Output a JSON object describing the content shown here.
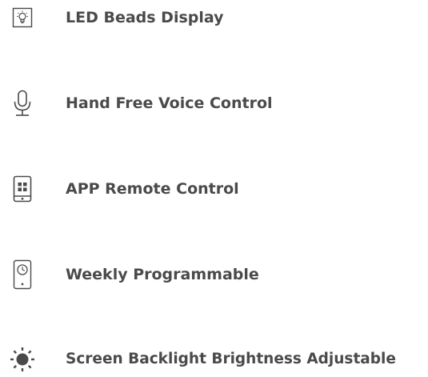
{
  "colors": {
    "text": "#4a4a4a",
    "icon": "#4a4a4a"
  },
  "features": [
    {
      "label": "LED Beads Display",
      "icon": "led-bulb-icon"
    },
    {
      "label": "Hand Free Voice Control",
      "icon": "microphone-icon"
    },
    {
      "label": "APP Remote Control",
      "icon": "phone-app-icon"
    },
    {
      "label": "Weekly Programmable",
      "icon": "clock-device-icon"
    },
    {
      "label": "Screen Backlight Brightness Adjustable",
      "icon": "sun-brightness-icon"
    }
  ]
}
